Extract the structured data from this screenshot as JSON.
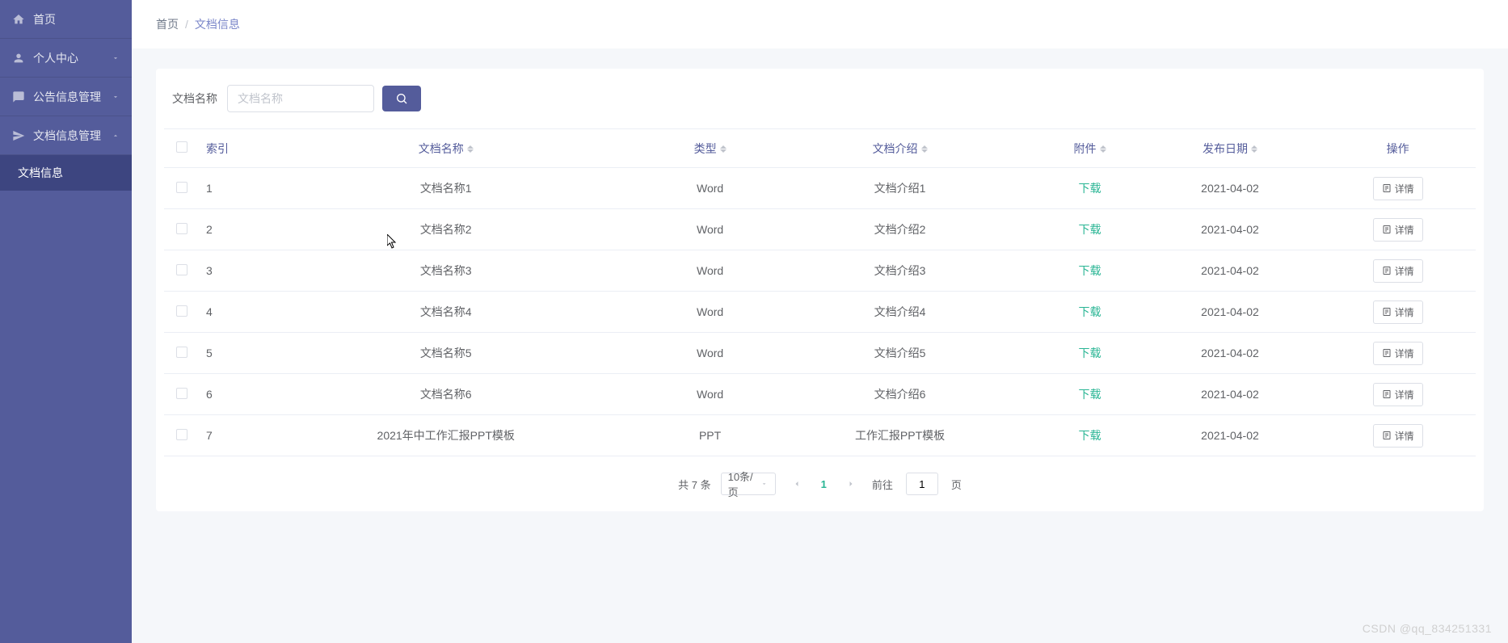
{
  "sidebar": {
    "items": [
      {
        "label": "首页",
        "icon": "home"
      },
      {
        "label": "个人中心",
        "icon": "user",
        "expandable": true
      },
      {
        "label": "公告信息管理",
        "icon": "message",
        "expandable": true
      },
      {
        "label": "文档信息管理",
        "icon": "send",
        "expandable": true,
        "expanded": true
      }
    ],
    "submenu_label": "文档信息"
  },
  "breadcrumb": {
    "home": "首页",
    "current": "文档信息"
  },
  "search": {
    "label": "文档名称",
    "placeholder": "文档名称"
  },
  "table": {
    "headers": {
      "index": "索引",
      "name": "文档名称",
      "type": "类型",
      "intro": "文档介绍",
      "attachment": "附件",
      "date": "发布日期",
      "action": "操作"
    },
    "download_label": "下载",
    "detail_label": "详情",
    "rows": [
      {
        "idx": "1",
        "name": "文档名称1",
        "type": "Word",
        "intro": "文档介绍1",
        "date": "2021-04-02"
      },
      {
        "idx": "2",
        "name": "文档名称2",
        "type": "Word",
        "intro": "文档介绍2",
        "date": "2021-04-02"
      },
      {
        "idx": "3",
        "name": "文档名称3",
        "type": "Word",
        "intro": "文档介绍3",
        "date": "2021-04-02"
      },
      {
        "idx": "4",
        "name": "文档名称4",
        "type": "Word",
        "intro": "文档介绍4",
        "date": "2021-04-02"
      },
      {
        "idx": "5",
        "name": "文档名称5",
        "type": "Word",
        "intro": "文档介绍5",
        "date": "2021-04-02"
      },
      {
        "idx": "6",
        "name": "文档名称6",
        "type": "Word",
        "intro": "文档介绍6",
        "date": "2021-04-02"
      },
      {
        "idx": "7",
        "name": "2021年中工作汇报PPT模板",
        "type": "PPT",
        "intro": "工作汇报PPT模板",
        "date": "2021-04-02"
      }
    ]
  },
  "pagination": {
    "total_text": "共 7 条",
    "per_page": "10条/页",
    "current": "1",
    "goto_prefix": "前往",
    "goto_value": "1",
    "goto_suffix": "页"
  },
  "watermark": "CSDN @qq_834251331"
}
